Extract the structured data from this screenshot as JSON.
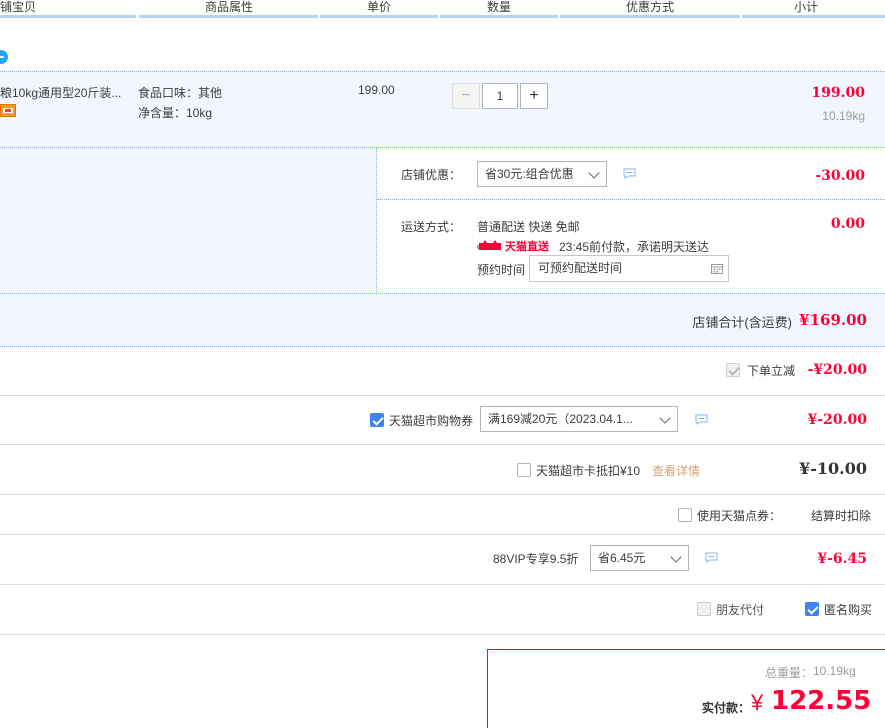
{
  "header": {
    "col_item": "铺宝贝",
    "col_attr": "商品属性",
    "col_price": "单价",
    "col_qty": "数量",
    "col_promo": "优惠方式",
    "col_subtotal": "小计"
  },
  "item": {
    "title": "粮10kg通用型20斤装...",
    "attr_flavor": "食品口味：其他",
    "attr_weight": "净含量：10kg",
    "unit_price": "199.00",
    "qty_minus": "−",
    "quantity": "1",
    "qty_plus": "+",
    "subtotal": "199.00",
    "weight": "10.19kg"
  },
  "shop": {
    "promo_label": "店铺优惠：",
    "promo_selected": "省30元:组合优惠",
    "promo_amount": "-30.00",
    "shipping_label": "运送方式：",
    "shipping_desc": "普通配送 快递 免邮",
    "direct_brand": "天猫直送",
    "direct_note": "23:45前付款，承诺明天送达",
    "reserve_label": "预约时间",
    "reserve_placeholder": "可预约配送时间",
    "shipping_amount": "0.00",
    "total_label": "店铺合计(含运费)",
    "total_amount": "¥169.00"
  },
  "discounts": {
    "instant_label": "下单立减",
    "instant_amount": "-¥20.00",
    "coupon_label": "天猫超市购物券",
    "coupon_selected": "满169减20元（2023.04.1...",
    "coupon_amount": "¥-20.00",
    "card_label": "天猫超市卡抵扣¥10",
    "card_link": "查看详情",
    "card_amount": "¥-10.00",
    "points_label": "使用天猫点券：",
    "points_note": "结算时扣除",
    "vip_label": "88VIP专享9.5折",
    "vip_selected": "省6.45元",
    "vip_amount": "¥-6.45",
    "friend_pay_label": "朋友代付",
    "anonymous_label": "匿名购买"
  },
  "summary": {
    "weight_label": "总重量：",
    "weight_value": "10.19kg",
    "pay_label": "实付款：",
    "currency": "¥",
    "pay_amount": "122.55"
  },
  "colors": {
    "accent_red": "#ff0036",
    "light_blue_bg": "#f2f7ff",
    "checkbox_blue": "#3d82f7",
    "link_orange": "#d6a27a"
  }
}
